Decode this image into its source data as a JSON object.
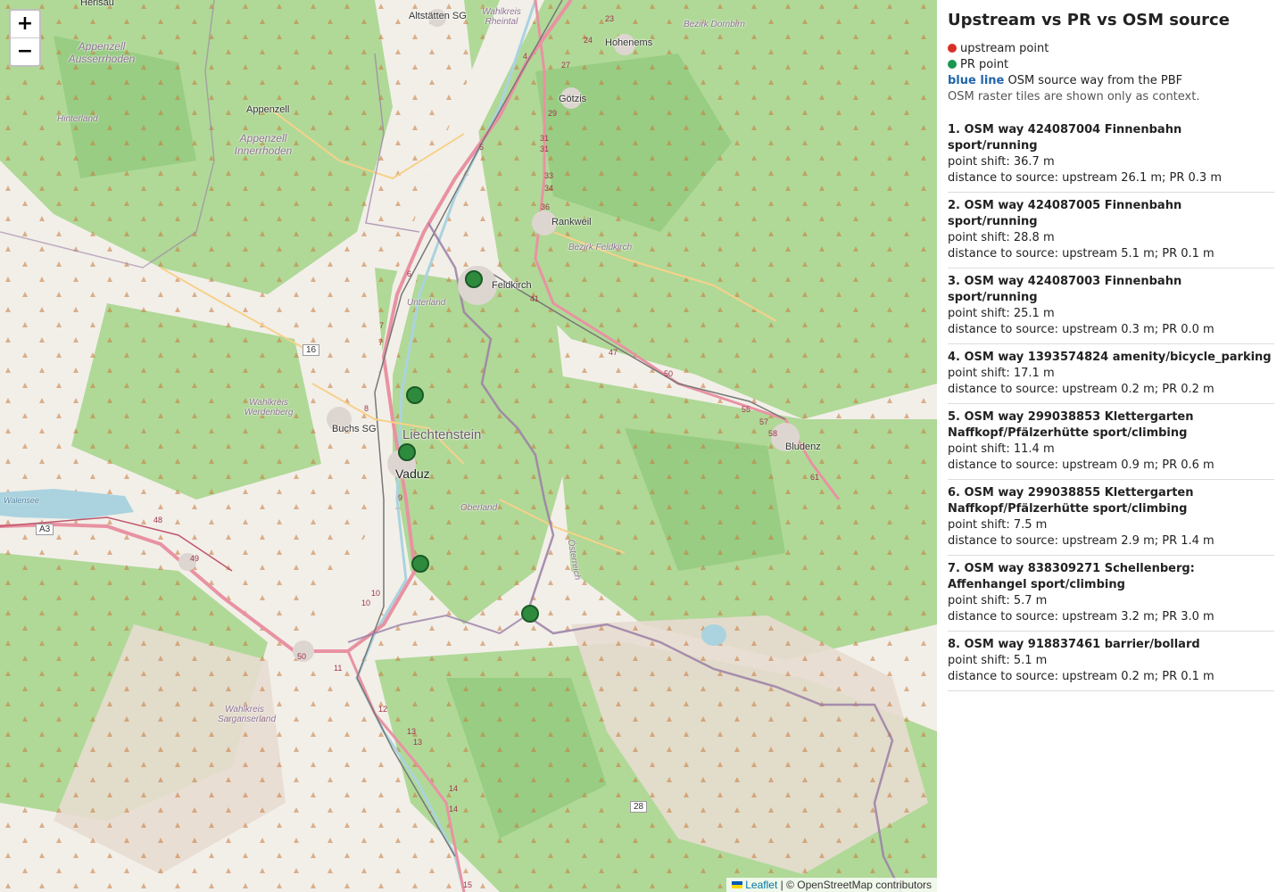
{
  "map": {
    "zoom_in": "+",
    "zoom_out": "−",
    "attribution_link": "Leaflet",
    "attribution_text": "| © OpenStreetMap contributors",
    "labels": {
      "herisau": "Herisau",
      "altstatten": "Altstätten SG",
      "wahlkreis_rheintal": "Wahlkreis Rheintal",
      "hohenems": "Hohenems",
      "bezirk_dornbirn": "Bezirk Dornbirn",
      "appenzell_ausserrhoden": "Appenzell Ausserrhoden",
      "hinterland": "Hinterland",
      "appenzell": "Appenzell",
      "appenzell_innerrhoden": "Appenzell Innerrhoden",
      "gotzis": "Götzis",
      "rankweil": "Rankweil",
      "bezirk_feldkirch": "Bezirk Feldkirch",
      "feldkirch": "Feldkirch",
      "unterland": "Unterland",
      "wahlkreis_werdenberg": "Wahlkreis Werdenberg",
      "liechtenstein": "Liechtenstein",
      "buchs": "Buchs SG",
      "vaduz": "Vaduz",
      "bludenz": "Bludenz",
      "oberland": "Oberland",
      "walensee": "Walensee",
      "osterreich": "Österreich",
      "wahlkreis_sarganserland": "Wahlkreis Sarganserland"
    },
    "shields": {
      "a3": "A3",
      "r16": "16",
      "r28": "28"
    },
    "route_numbers": [
      "23",
      "24",
      "4",
      "27",
      "29",
      "5",
      "31",
      "31",
      "33",
      "34",
      "36",
      "6",
      "7",
      "7",
      "8",
      "9",
      "41",
      "47",
      "50",
      "55",
      "57",
      "58",
      "61",
      "48",
      "49",
      "10",
      "10",
      "50",
      "11",
      "12",
      "13",
      "13",
      "14",
      "14",
      "15"
    ],
    "markers_label": "PR point"
  },
  "panel": {
    "title": "Upstream vs PR vs OSM source",
    "legend_upstream": "upstream point",
    "legend_pr": "PR point",
    "legend_blue_strong": "blue line",
    "legend_blue_rest": " OSM source way from the PBF",
    "legend_note": "OSM raster tiles are shown only as context.",
    "colors": {
      "upstream": "#d73027",
      "pr": "#1a9850",
      "source": "#2166ac"
    },
    "items": [
      {
        "title": "1. OSM way 424087004 Finnenbahn sport/running",
        "shift": "point shift: 36.7 m",
        "dist": "distance to source: upstream 26.1 m; PR 0.3 m"
      },
      {
        "title": "2. OSM way 424087005 Finnenbahn sport/running",
        "shift": "point shift: 28.8 m",
        "dist": "distance to source: upstream 5.1 m; PR 0.1 m"
      },
      {
        "title": "3. OSM way 424087003 Finnenbahn sport/running",
        "shift": "point shift: 25.1 m",
        "dist": "distance to source: upstream 0.3 m; PR 0.0 m"
      },
      {
        "title": "4. OSM way 1393574824 amenity/bicycle_parking",
        "shift": "point shift: 17.1 m",
        "dist": "distance to source: upstream 0.2 m; PR 0.2 m"
      },
      {
        "title": "5. OSM way 299038853 Klettergarten Naffkopf/Pfälzerhütte sport/climbing",
        "shift": "point shift: 11.4 m",
        "dist": "distance to source: upstream 0.9 m; PR 0.6 m"
      },
      {
        "title": "6. OSM way 299038855 Klettergarten Naffkopf/Pfälzerhütte sport/climbing",
        "shift": "point shift: 7.5 m",
        "dist": "distance to source: upstream 2.9 m; PR 1.4 m"
      },
      {
        "title": "7. OSM way 838309271 Schellenberg: Affenhangel sport/climbing",
        "shift": "point shift: 5.7 m",
        "dist": "distance to source: upstream 3.2 m; PR 3.0 m"
      },
      {
        "title": "8. OSM way 918837461 barrier/bollard",
        "shift": "point shift: 5.1 m",
        "dist": "distance to source: upstream 0.2 m; PR 0.1 m"
      }
    ]
  }
}
